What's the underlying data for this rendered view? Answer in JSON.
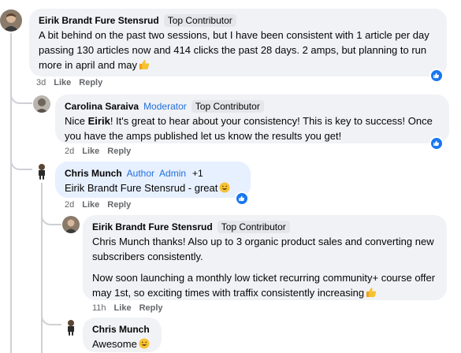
{
  "comments": [
    {
      "author": "Eirik Brandt Fure Stensrud",
      "badge": "Top Contributor",
      "text": "A bit behind on the past two sessions, but I have been consistent with 1 article per day passing 130 articles now and 414 clicks the past 28 days. 2 amps, but planning to run more in april and may",
      "time": "3d",
      "like": "Like",
      "reply": "Reply"
    },
    {
      "author": "Carolina Saraiva",
      "role": "Moderator",
      "badge": "Top Contributor",
      "text_before": "Nice ",
      "mention": "Eirik",
      "text_after": "! It's great to hear about your consistency! This is key to success! Once you have the amps published let us know the results you get!",
      "time": "2d",
      "like": "Like",
      "reply": "Reply"
    },
    {
      "author": "Chris Munch",
      "role_author": "Author",
      "role_admin": "Admin",
      "extra_count": "+1",
      "text": "Eirik Brandt Fure Stensrud - great",
      "time": "2d",
      "like": "Like",
      "reply": "Reply"
    },
    {
      "author": "Eirik Brandt Fure Stensrud",
      "badge": "Top Contributor",
      "paragraph1": "Chris Munch thanks! Also up to 3 organic product sales and converting new subscribers consistently.",
      "paragraph2": "Now soon launching a monthly low ticket recurring community+ course offer may 1st, so exciting times with traffix consistently increasing",
      "time": "11h",
      "like": "Like",
      "reply": "Reply"
    },
    {
      "author": "Chris Munch",
      "text": "Awesome"
    }
  ]
}
